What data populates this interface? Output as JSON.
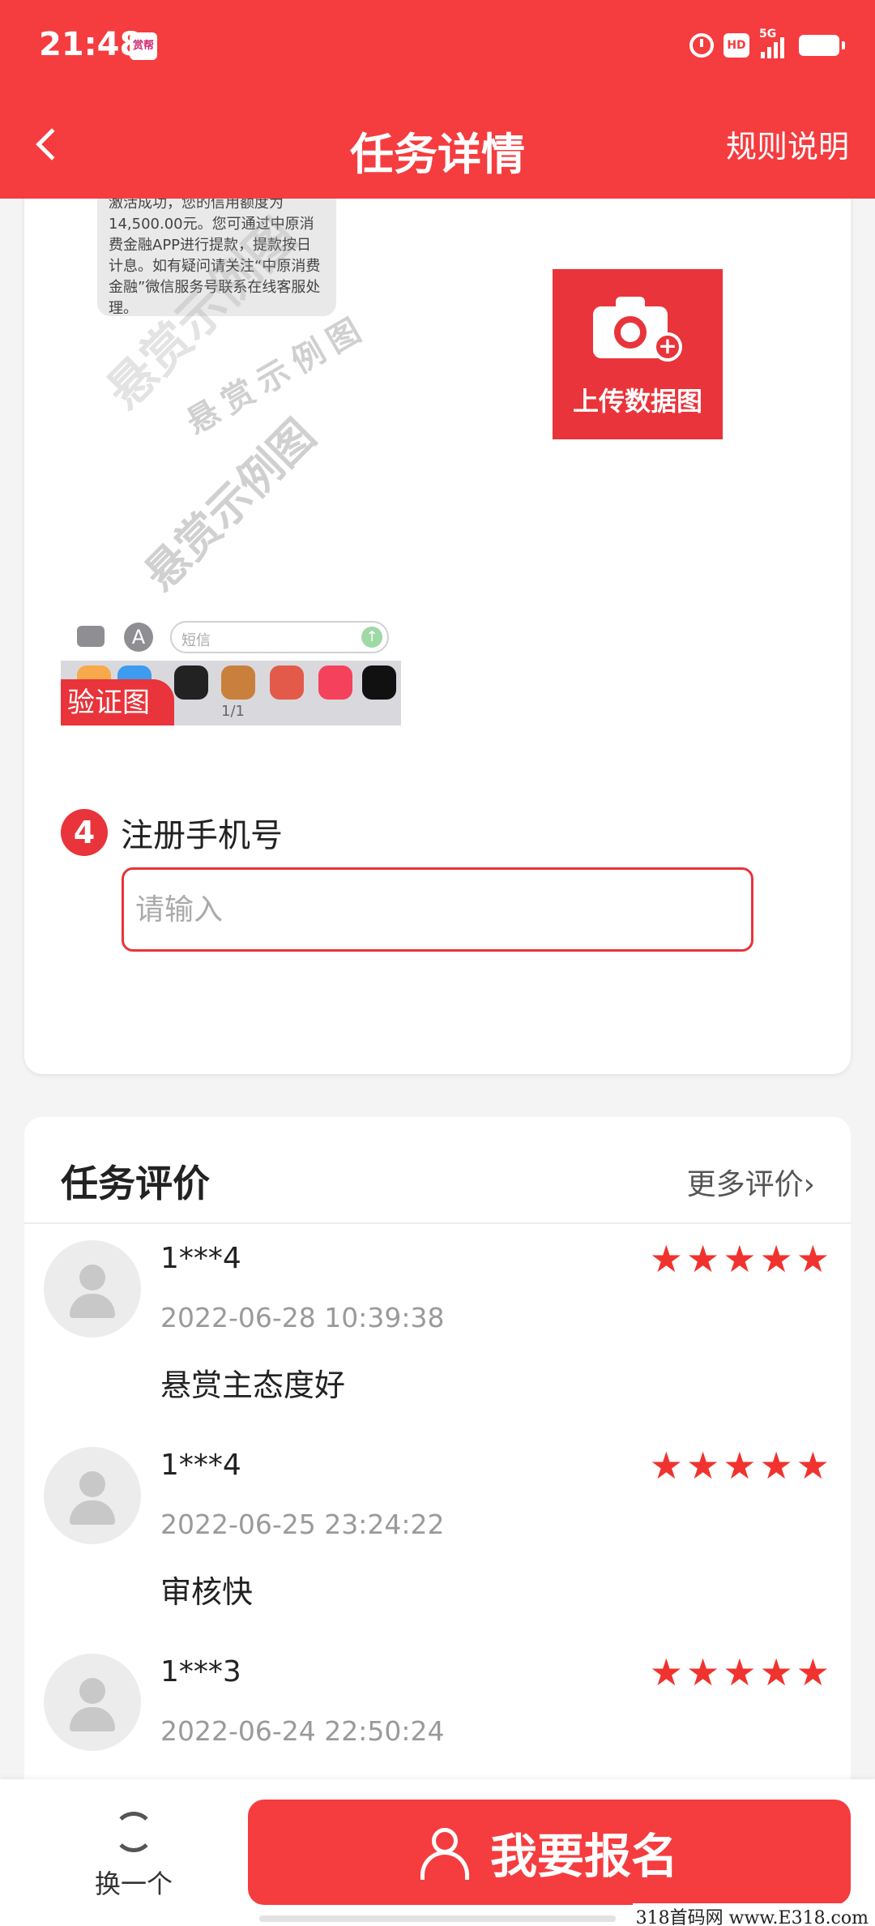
{
  "status_bar": {
    "time": "21:48",
    "app_badge": "赏帮",
    "network": "5G",
    "hd": "HD"
  },
  "nav": {
    "title": "任务详情",
    "rules_link": "规则说明"
  },
  "sample": {
    "sms_text": "激活成功，您的信用额度为14,500.00元。您可通过中原消费金融APP进行提款，提款按日计息。如有疑问请关注“中原消费金融”微信服务号联系在线客服处理。",
    "watermark": "悬赏示例图",
    "sms_placeholder": "短信",
    "page_indicator": "1/1",
    "verify_tag": "验证图"
  },
  "upload": {
    "label": "上传数据图"
  },
  "step4": {
    "number": "4",
    "label": "注册手机号",
    "placeholder": "请输入"
  },
  "reviews": {
    "title": "任务评价",
    "more": "更多评价",
    "items": [
      {
        "user": "1***4",
        "time": "2022-06-28 10:39:38",
        "text": "悬赏主态度好",
        "stars": 5
      },
      {
        "user": "1***4",
        "time": "2022-06-25 23:24:22",
        "text": "审核快",
        "stars": 5
      },
      {
        "user": "1***3",
        "time": "2022-06-24 22:50:24",
        "text": "",
        "stars": 5
      }
    ]
  },
  "bottom": {
    "swap_label": "换一个",
    "signup_label": "我要报名"
  },
  "site_watermark": "318首码网 www.E318.com",
  "colors": {
    "primary": "#f53c3f",
    "star": "#f0332e"
  }
}
